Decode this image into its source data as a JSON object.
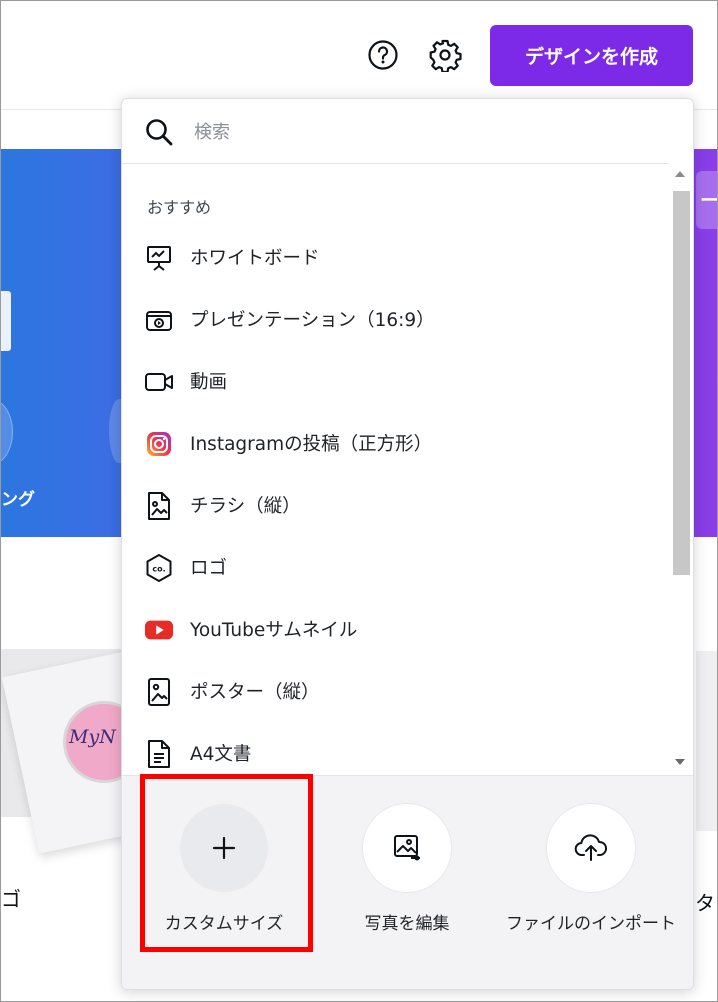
{
  "header": {
    "help_icon": "question-circle-icon",
    "settings_icon": "gear-icon",
    "create_button": "デザインを作成",
    "accent_color": "#7d2ae8"
  },
  "background": {
    "hero_text_left": "ング",
    "hero_right_tab": "ー",
    "thumb_text": "MyN",
    "label_left": "ゴ",
    "label_right": "タ"
  },
  "popup": {
    "search": {
      "placeholder": "検索"
    },
    "section_label": "おすすめ",
    "items": [
      {
        "label": "ホワイトボード",
        "icon": "whiteboard-icon"
      },
      {
        "label": "プレゼンテーション（16:9）",
        "icon": "presentation-icon"
      },
      {
        "label": "動画",
        "icon": "video-icon"
      },
      {
        "label": "Instagramの投稿（正方形）",
        "icon": "instagram-icon"
      },
      {
        "label": "チラシ（縦）",
        "icon": "flyer-icon"
      },
      {
        "label": "ロゴ",
        "icon": "logo-icon"
      },
      {
        "label": "YouTubeサムネイル",
        "icon": "youtube-icon"
      },
      {
        "label": "ポスター（縦）",
        "icon": "poster-icon"
      },
      {
        "label": "A4文書",
        "icon": "document-icon"
      }
    ],
    "actions": [
      {
        "label": "カスタムサイズ",
        "icon": "plus-icon"
      },
      {
        "label": "写真を編集",
        "icon": "edit-photo-icon"
      },
      {
        "label": "ファイルのインポート",
        "icon": "cloud-upload-icon"
      }
    ]
  }
}
